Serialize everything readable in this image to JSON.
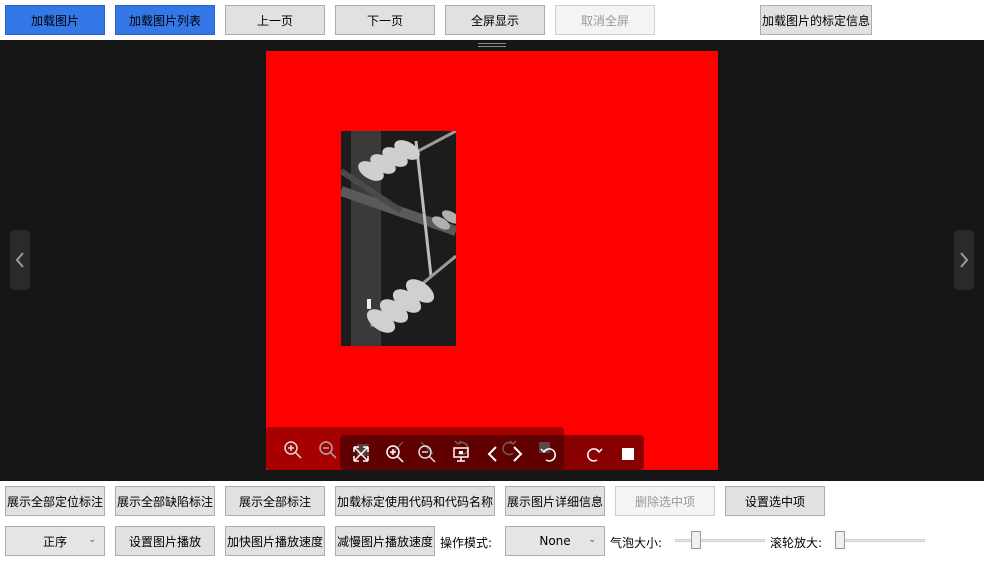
{
  "top_toolbar": {
    "load_image": "加载图片",
    "load_image_list": "加载图片列表",
    "prev_page": "上一页",
    "next_page": "下一页",
    "fullscreen": "全屏显示",
    "exit_fullscreen": "取消全屏",
    "load_calibration": "加载图片的标定信息"
  },
  "viewer": {
    "left_arrow": "‹",
    "right_arrow": "›",
    "canvas_color": "#ff0000",
    "toolbar_icons": [
      "zoom-in-icon",
      "zoom-out-icon",
      "fit-screen-icon",
      "zoom-in-icon",
      "zoom-out-icon",
      "rotate-left-icon",
      "rotate-right-icon",
      "presentation-icon",
      "previous-icon",
      "next-icon",
      "reset-icon",
      "redo-icon",
      "stop-icon"
    ]
  },
  "bottom_row1": {
    "show_all_locate": "展示全部定位标注",
    "show_all_defect": "展示全部缺陷标注",
    "show_all": "展示全部标注",
    "load_calib_codes": "加载标定使用代码和代码名称",
    "show_image_detail": "展示图片详细信息",
    "delete_selected": "删除选中项",
    "set_selected": "设置选中项"
  },
  "bottom_row2": {
    "order_value": "正序",
    "set_playback": "设置图片播放",
    "speed_up": "加快图片播放速度",
    "slow_down": "减慢图片播放速度",
    "mode_label": "操作模式:",
    "mode_value": "None",
    "bubble_label": "气泡大小:",
    "wheel_label": "滚轮放大:"
  }
}
